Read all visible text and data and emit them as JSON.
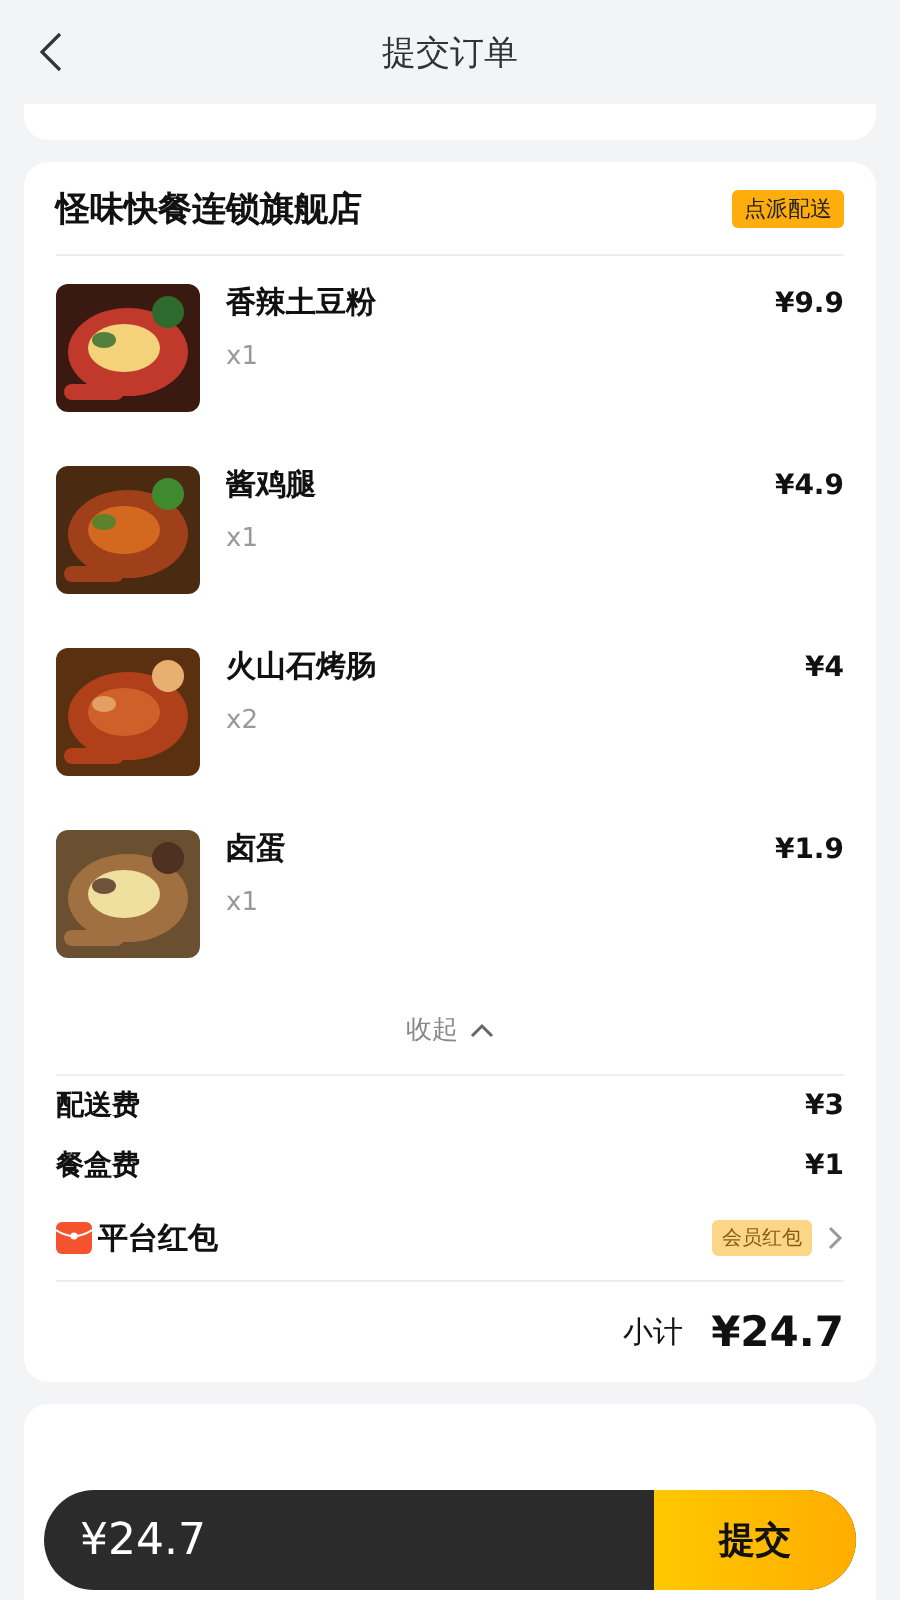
{
  "header": {
    "title": "提交订单"
  },
  "store": {
    "name": "怪味快餐连锁旗舰店",
    "tag": "点派配送",
    "items": [
      {
        "name": "香辣土豆粉",
        "qty": "x1",
        "price": "¥9.9"
      },
      {
        "name": "酱鸡腿",
        "qty": "x1",
        "price": "¥4.9"
      },
      {
        "name": "火山石烤肠",
        "qty": "x2",
        "price": "¥4"
      },
      {
        "name": "卤蛋",
        "qty": "x1",
        "price": "¥1.9"
      }
    ],
    "collapse": "收起",
    "fees": [
      {
        "label": "配送费",
        "value": "¥3"
      },
      {
        "label": "餐盒费",
        "value": "¥1"
      }
    ],
    "coupon": {
      "label": "平台红包",
      "tag": "会员红包"
    },
    "subtotal": {
      "label": "小计",
      "value": "¥24.7"
    }
  },
  "bottom_bar": {
    "total": "¥24.7",
    "submit": "提交"
  }
}
